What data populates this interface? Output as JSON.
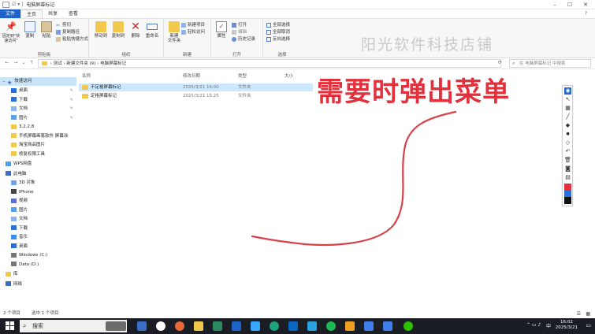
{
  "window": {
    "title": "电脑屏幕标记"
  },
  "tabs": [
    "文件",
    "主页",
    "共享",
    "查看"
  ],
  "ribbon": {
    "clipboard": {
      "pin": "固定到\"快速访问\"",
      "copy": "复制",
      "paste": "粘贴",
      "cut": "剪切",
      "copy_path": "复制路径",
      "paste_shortcut": "粘贴快捷方式",
      "label": "剪贴板"
    },
    "organize": {
      "move_to": "移动到",
      "copy_to": "复制到",
      "delete": "删除",
      "rename": "重命名",
      "label": "组织"
    },
    "new": {
      "new_folder": "新建\n文件夹",
      "new_item": "新建项目",
      "easy_access": "轻松访问",
      "label": "新建"
    },
    "open": {
      "properties": "属性",
      "open": "打开",
      "edit": "编辑",
      "history": "历史记录",
      "label": "打开"
    },
    "select": {
      "select_all": "全部选择",
      "select_none": "全部取消",
      "invert": "反向选择",
      "label": "选择"
    },
    "watermark": "阳光软件科技店铺"
  },
  "address": {
    "path": "›  测试  ›  新建文件夹 (9)  ›  电脑屏幕标记",
    "search_placeholder": "在 电脑屏幕标记 中搜索"
  },
  "nav": {
    "quick_access": "快速访问",
    "items": [
      {
        "label": "桌面",
        "pinned": true
      },
      {
        "label": "下载",
        "pinned": true
      },
      {
        "label": "文档",
        "pinned": true
      },
      {
        "label": "图片",
        "pinned": true
      },
      {
        "label": "3.2.2.8",
        "pinned": false
      },
      {
        "label": "手机屏幕画笔软件 屏幕涂",
        "pinned": false
      },
      {
        "label": "淘宝商品图片",
        "pinned": false
      },
      {
        "label": "修复权限工具",
        "pinned": false
      }
    ],
    "wps": "WPS网盘",
    "this_pc": "此电脑",
    "pc_items": [
      "3D 对象",
      "iPhone",
      "视频",
      "图片",
      "文档",
      "下载",
      "音乐",
      "桌面",
      "Windows (C:)",
      "Data (D:)"
    ],
    "library": "库",
    "network": "网络"
  },
  "columns": {
    "name": "名称",
    "date": "修改日期",
    "type": "类型",
    "size": "大小"
  },
  "files": [
    {
      "name": "不定格屏幕标记",
      "date": "2025/3/21 16:00",
      "type": "文件夹",
      "selected": true
    },
    {
      "name": "定格屏幕标记",
      "date": "2025/3/21 15:25",
      "type": "文件夹",
      "selected": false
    }
  ],
  "status": {
    "count": "2 个项目",
    "selected": "选中 1 个项目"
  },
  "taskbar": {
    "search": "搜索",
    "lang": "中",
    "time": "16:02",
    "date": "2025/3/21"
  },
  "annotation": {
    "text": "需要时弹出菜单",
    "color": "#e2313c"
  },
  "colors": {
    "accent": "#1e63c9",
    "selection": "#cce8ff"
  }
}
